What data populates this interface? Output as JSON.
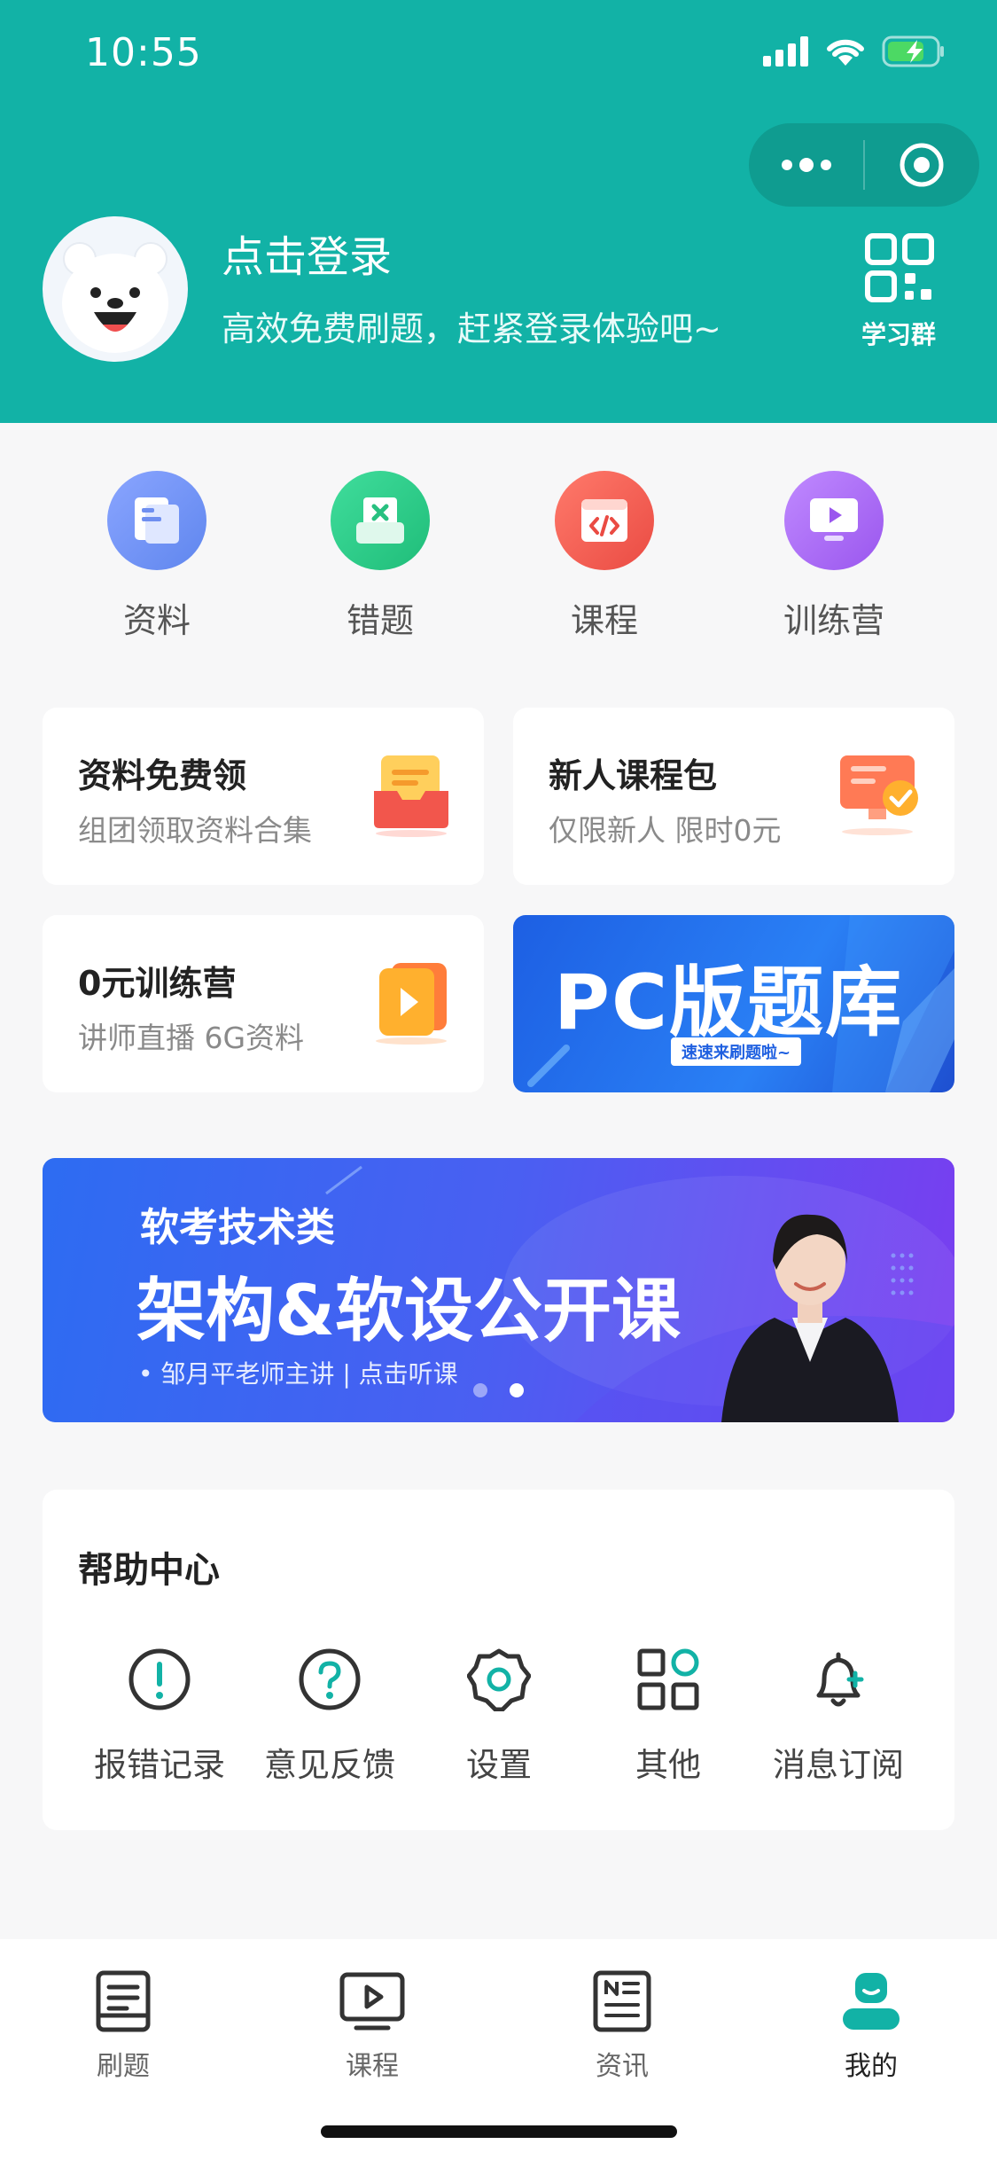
{
  "status_bar": {
    "time": "10:55"
  },
  "profile": {
    "title": "点击登录",
    "subtitle": "高效免费刷题，赶紧登录体验吧~",
    "qr_label": "学习群"
  },
  "shortcuts": [
    {
      "label": "资料",
      "icon": "document-icon",
      "color": "#6b8ef5"
    },
    {
      "label": "错题",
      "icon": "wrong-question-icon",
      "color": "#2fcf8a"
    },
    {
      "label": "课程",
      "icon": "code-course-icon",
      "color": "#f2564c"
    },
    {
      "label": "训练营",
      "icon": "monitor-play-icon",
      "color": "#a463f0"
    }
  ],
  "promo_cards": [
    {
      "title": "资料免费领",
      "subtitle": "组团领取资料合集",
      "icon": "inbox-tray-icon"
    },
    {
      "title": "新人课程包",
      "subtitle": "仅限新人 限时0元",
      "icon": "monitor-check-icon"
    },
    {
      "title": "0元训练营",
      "subtitle": "讲师直播 6G资料",
      "icon": "video-play-icon"
    }
  ],
  "pc_banner": {
    "title": "PC版题库",
    "tag": "速速来刷题啦~"
  },
  "hero_banner": {
    "line1": "软考技术类",
    "line2": "架构&软设公开课",
    "line3": "• 邹月平老师主讲 | 点击听课",
    "active_dot": 1
  },
  "help_center": {
    "title": "帮助中心",
    "items": [
      {
        "label": "报错记录",
        "icon": "exclamation-circle-icon"
      },
      {
        "label": "意见反馈",
        "icon": "question-circle-icon"
      },
      {
        "label": "设置",
        "icon": "gear-icon"
      },
      {
        "label": "其他",
        "icon": "grid-apps-icon"
      },
      {
        "label": "消息订阅",
        "icon": "bell-plus-icon"
      }
    ]
  },
  "tabbar": {
    "items": [
      {
        "label": "刷题",
        "icon": "question-book-icon",
        "active": false
      },
      {
        "label": "课程",
        "icon": "video-screen-icon",
        "active": false
      },
      {
        "label": "资讯",
        "icon": "news-icon",
        "active": false
      },
      {
        "label": "我的",
        "icon": "user-profile-icon",
        "active": true
      }
    ]
  },
  "colors": {
    "primary": "#12b2a6",
    "banner_blue": "#2f6cf0",
    "banner_purple": "#7a3df0"
  }
}
